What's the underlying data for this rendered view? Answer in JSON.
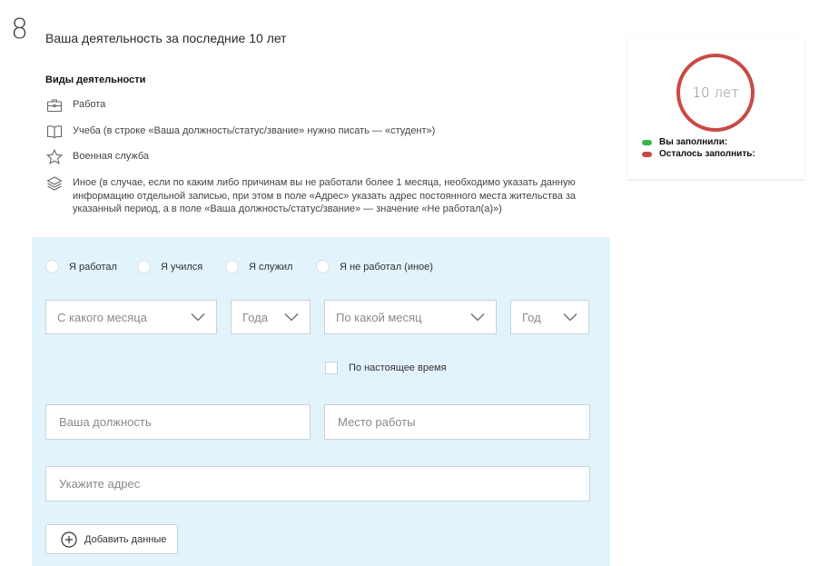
{
  "step": {
    "number": "8",
    "title": "Ваша деятельность за последние 10 лет"
  },
  "activity_types": {
    "heading": "Виды деятельности",
    "items": [
      {
        "icon": "briefcase-icon",
        "label": "Работа"
      },
      {
        "icon": "book-icon",
        "label": "Учеба (в строке «Ваша должность/статус/звание» нужно писать — «студент»)"
      },
      {
        "icon": "star-icon",
        "label": "Военная служба"
      },
      {
        "icon": "layers-icon",
        "label": "Иное (в случае, если по каким либо причинам вы не работали более 1 месяца, необходимо указать данную информацию отдельной записью, при этом в поле «Адрес» указать адрес постоянного места жительства за указанный период, а в поле «Ваша должность/статус/звание» — значение «Не работал(а)»)"
      }
    ]
  },
  "progress": {
    "value": "10 лет",
    "legend": [
      {
        "label": "Вы заполнили:",
        "color": "#3bb54a"
      },
      {
        "label": "Осталось заполнить:",
        "color": "#c94a45"
      }
    ]
  },
  "form": {
    "radios": [
      "Я работал",
      "Я учился",
      "Я служил",
      "Я не работал (иное)"
    ],
    "selects": {
      "from_month": "С какого месяца",
      "from_year": "Года",
      "to_month": "По какой месяц",
      "to_year": "Год"
    },
    "checkbox_label": "По настоящее время",
    "position_placeholder": "Ваша должность",
    "workplace_placeholder": "Место работы",
    "address_placeholder": "Укажите адрес",
    "add_button_label": "Добавить данные"
  },
  "colors": {
    "panel": "#e2f3fb",
    "ring": "#c94a45",
    "filled": "#3bb54a",
    "remaining": "#c94a45"
  }
}
